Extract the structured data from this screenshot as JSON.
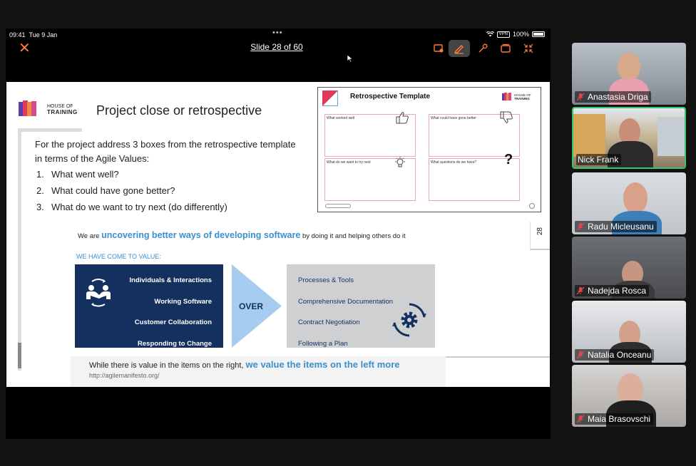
{
  "status_bar": {
    "time": "09:41",
    "date": "Tue 9 Jan",
    "vpn": "VPN",
    "battery": "100%"
  },
  "toolbar": {
    "slide_counter": "Slide 28 of 60"
  },
  "slide": {
    "logo": {
      "line1": "HOUSE OF",
      "line2": "TRAINING"
    },
    "title": "Project close or retrospective",
    "intro": "For the project address 3 boxes from the retrospective template in terms of the Agile Values:",
    "questions": [
      {
        "num": "1.",
        "text": "What went well?"
      },
      {
        "num": "2.",
        "text": "What could have gone better?"
      },
      {
        "num": "3.",
        "text": "What do we want to try next (do differently)"
      }
    ],
    "retro": {
      "title": "Retrospective Template",
      "logo_line1": "HOUSE OF",
      "logo_line2": "TRAINING",
      "boxes": [
        "What worked well",
        "What could have gone better",
        "What do we want to try next",
        "What questions do we have?"
      ],
      "question_mark": "?"
    },
    "page_number": "28",
    "manifesto": {
      "uncover_pre": "We are ",
      "uncover_bold": "uncovering better ways of developing software",
      "uncover_post": " by doing it and helping others do it",
      "we_have": "WE HAVE COME TO VALUE:",
      "left_values": [
        "Individuals & Interactions",
        "Working Software",
        "Customer Collaboration",
        "Responding to Change"
      ],
      "over": "OVER",
      "right_values": [
        "Processes & Tools",
        "Comprehensive Documentation",
        "Contract Negotiation",
        "Following a Plan"
      ],
      "while_pre": "While there is value in the items on the right, ",
      "while_bold": "we value the items on the left more",
      "url": "http://agilemanifesto.org/"
    }
  },
  "participants": [
    {
      "name": "Anastasia Driga",
      "muted": true
    },
    {
      "name": "Nick Frank",
      "muted": false,
      "active": true
    },
    {
      "name": "Radu Micleusanu",
      "muted": true
    },
    {
      "name": "Nadejda Rosca",
      "muted": true
    },
    {
      "name": "Natalia Onceanu",
      "muted": true
    },
    {
      "name": "Maia Brasovschi",
      "muted": true
    }
  ],
  "colors": {
    "accent": "#3a8fce",
    "navy": "#13305e",
    "close": "#ff7a3d",
    "active_speaker": "#39c46d",
    "mute_red": "#e0474c"
  }
}
